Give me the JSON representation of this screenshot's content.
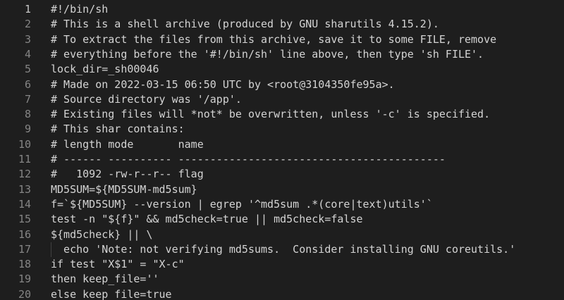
{
  "editor": {
    "active_line": 1,
    "lines": [
      {
        "number": "1",
        "text": "#!/bin/sh"
      },
      {
        "number": "2",
        "text": "# This is a shell archive (produced by GNU sharutils 4.15.2)."
      },
      {
        "number": "3",
        "text": "# To extract the files from this archive, save it to some FILE, remove"
      },
      {
        "number": "4",
        "text": "# everything before the '#!/bin/sh' line above, then type 'sh FILE'."
      },
      {
        "number": "5",
        "text": "lock_dir=_sh00046"
      },
      {
        "number": "6",
        "text": "# Made on 2022-03-15 06:50 UTC by <root@3104350fe95a>."
      },
      {
        "number": "7",
        "text": "# Source directory was '/app'."
      },
      {
        "number": "8",
        "text": "# Existing files will *not* be overwritten, unless '-c' is specified."
      },
      {
        "number": "9",
        "text": "# This shar contains:"
      },
      {
        "number": "10",
        "text": "# length mode       name"
      },
      {
        "number": "11",
        "text": "# ------ ---------- ------------------------------------------"
      },
      {
        "number": "12",
        "text": "#   1092 -rw-r--r-- flag"
      },
      {
        "number": "13",
        "text": "MD5SUM=${MD5SUM-md5sum}"
      },
      {
        "number": "14",
        "text": "f=`${MD5SUM} --version | egrep '^md5sum .*(core|text)utils'`"
      },
      {
        "number": "15",
        "text": "test -n \"${f}\" && md5check=true || md5check=false"
      },
      {
        "number": "16",
        "text": "${md5check} || \\"
      },
      {
        "number": "17",
        "text": "  echo 'Note: not verifying md5sums.  Consider installing GNU coreutils.'"
      },
      {
        "number": "18",
        "text": "if test \"X$1\" = \"X-c\""
      },
      {
        "number": "19",
        "text": "then keep_file=''"
      },
      {
        "number": "20",
        "text": "else keep_file=true"
      }
    ]
  }
}
